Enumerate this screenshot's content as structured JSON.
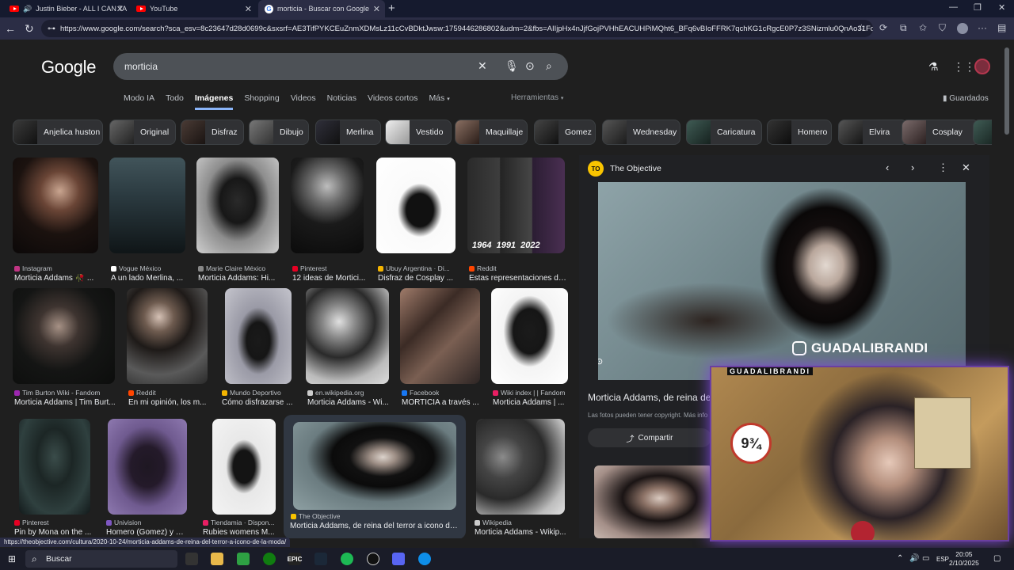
{
  "browser": {
    "tabs": [
      {
        "title": "Justin Bieber - ALL I CAN TA",
        "icon": "youtube-icon"
      },
      {
        "title": "YouTube",
        "icon": "youtube-icon"
      },
      {
        "title": "morticia - Buscar con Google",
        "icon": "google-icon",
        "active": true
      }
    ],
    "url": "https://www.google.com/search?sca_esv=8c23647d28d0699c&sxsrf=AE3TifPYKCEuZnmXDMsLz11cCvBDktJwsw:1759446286802&udm=2&fbs=AIIjpHx4nJjfGojPVHhEACUHPiMQht6_BFq6vBIoFFRK7qchKG1cRgcE0P7z3SNizmlu0QnAo31FcWSm...",
    "status_url": "https://theobjective.com/cultura/2020-10-24/morticia-addams-de-reina-del-terror-a-icono-de-la-moda/"
  },
  "google": {
    "logo": "Google",
    "query": "morticia",
    "tabs": [
      "Modo IA",
      "Todo",
      "Imágenes",
      "Shopping",
      "Videos",
      "Noticias",
      "Videos cortos",
      "Más"
    ],
    "active_tab": "Imágenes",
    "tools": "Herramientas",
    "saved": "Guardados",
    "chips": [
      "Anjelica huston",
      "Original",
      "Disfraz",
      "Dibujo",
      "Merlina",
      "Vestido",
      "Maquillaje",
      "Gomez",
      "Wednesday",
      "Caricatura",
      "Homero",
      "Elvira",
      "Cosplay"
    ]
  },
  "results": [
    {
      "source": "Instagram",
      "title": "Morticia Addams 🥀 ...",
      "fav": "#c13584"
    },
    {
      "source": "Vogue México",
      "title": "A un lado Merlina, ...",
      "fav": "#ffffff"
    },
    {
      "source": "Marie Claire México",
      "title": "Morticia Addams: Hi...",
      "fav": "#888888"
    },
    {
      "source": "Pinterest",
      "title": "12 ideas de Mortici...",
      "fav": "#e60023"
    },
    {
      "source": "Ubuy Argentina · Di...",
      "title": "Disfraz de Cosplay ...",
      "fav": "#f4b400"
    },
    {
      "source": "Reddit",
      "title": "Estas representaciones de...",
      "fav": "#ff4500",
      "overlay": "1964  1991  2022"
    },
    {
      "source": "Tim Burton Wiki - Fandom",
      "title": "Morticia Addams | Tim Burt...",
      "fav": "#9c27b0"
    },
    {
      "source": "Reddit",
      "title": "En mi opinión, los m...",
      "fav": "#ff4500"
    },
    {
      "source": "Mundo Deportivo",
      "title": "Cómo disfrazarse ...",
      "fav": "#f4b400"
    },
    {
      "source": "en.wikipedia.org",
      "title": "Morticia Addams - Wi...",
      "fav": "#cccccc"
    },
    {
      "source": "Facebook",
      "title": "MORTICIA a través ...",
      "fav": "#1877f2"
    },
    {
      "source": "Wiki index | | Fandom",
      "title": "Morticia Addams | ...",
      "fav": "#e91e63"
    },
    {
      "source": "Pinterest",
      "title": "Pin by Mona on the ...",
      "fav": "#e60023"
    },
    {
      "source": "Univision",
      "title": "Homero (Gomez) y M...",
      "fav": "#7e57c2"
    },
    {
      "source": "Tiendamia · Dispon...",
      "title": "Rubies womens M...",
      "fav": "#e91e63"
    },
    {
      "source": "The Objective",
      "title": "Morticia Addams, de reina del terror a icono de ...",
      "fav": "#f9c400"
    },
    {
      "source": "Wikipedia",
      "title": "Morticia Addams - Wikip...",
      "fav": "#cccccc"
    }
  ],
  "panel": {
    "site": "The Objective",
    "site_logo": "TO",
    "watermark": "GUADALIBRANDI",
    "title": "Morticia Addams, de reina del",
    "copyright": "Las fotos pueden tener copyright. Más info",
    "share": "Compartir"
  },
  "stream_overlay": {
    "title": "GUADALIBRANDI"
  },
  "taskbar": {
    "search": "Buscar",
    "lang": "ESP",
    "time": "20:05",
    "date": "2/10/2025"
  }
}
